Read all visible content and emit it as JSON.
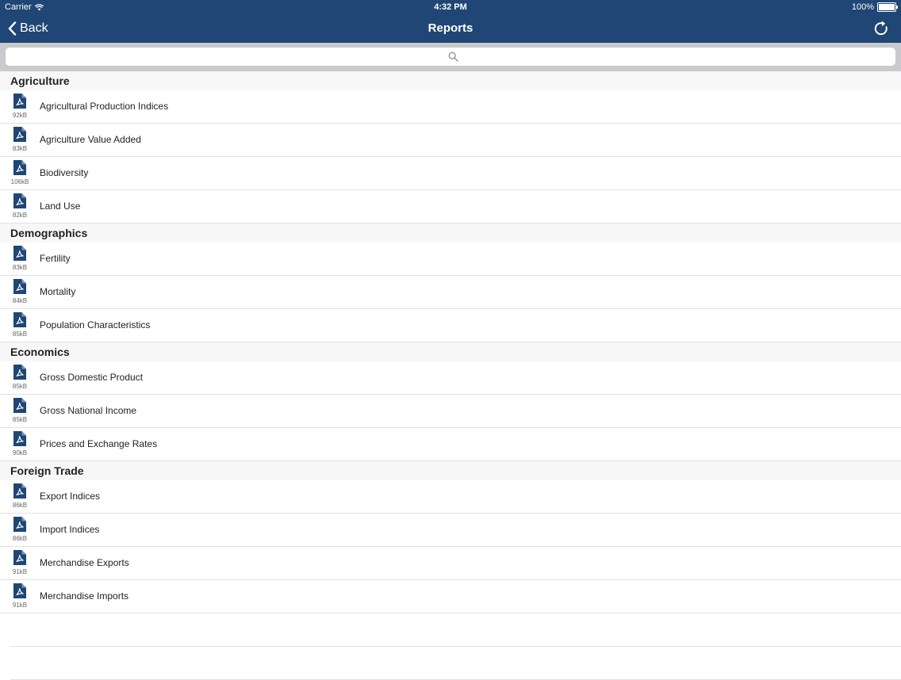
{
  "status_bar": {
    "carrier": "Carrier",
    "time": "4:32 PM",
    "battery": "100%",
    "battery_level": 1.0
  },
  "nav": {
    "back_label": "Back",
    "title": "Reports"
  },
  "search": {
    "placeholder": "",
    "value": ""
  },
  "colors": {
    "nav_background": "#1f4674",
    "pdf_icon": "#1f4674",
    "search_background": "#c9c9ce"
  },
  "sections": [
    {
      "title": "Agriculture",
      "items": [
        {
          "label": "Agricultural Production Indices",
          "size": "92kB",
          "icon": "pdf-icon"
        },
        {
          "label": "Agriculture Value Added",
          "size": "83kB",
          "icon": "pdf-icon"
        },
        {
          "label": "Biodiversity",
          "size": "106kB",
          "icon": "pdf-icon"
        },
        {
          "label": "Land Use",
          "size": "82kB",
          "icon": "pdf-icon"
        }
      ]
    },
    {
      "title": "Demographics",
      "items": [
        {
          "label": "Fertility",
          "size": "83kB",
          "icon": "pdf-icon"
        },
        {
          "label": "Mortality",
          "size": "84kB",
          "icon": "pdf-icon"
        },
        {
          "label": "Population Characteristics",
          "size": "85kB",
          "icon": "pdf-icon"
        }
      ]
    },
    {
      "title": "Economics",
      "items": [
        {
          "label": "Gross Domestic Product",
          "size": "85kB",
          "icon": "pdf-icon"
        },
        {
          "label": "Gross National Income",
          "size": "85kB",
          "icon": "pdf-icon"
        },
        {
          "label": "Prices and Exchange Rates",
          "size": "90kB",
          "icon": "pdf-icon"
        }
      ]
    },
    {
      "title": "Foreign Trade",
      "items": [
        {
          "label": "Export Indices",
          "size": "86kB",
          "icon": "pdf-icon"
        },
        {
          "label": "Import Indices",
          "size": "86kB",
          "icon": "pdf-icon"
        },
        {
          "label": "Merchandise Exports",
          "size": "91kB",
          "icon": "pdf-icon"
        },
        {
          "label": "Merchandise Imports",
          "size": "91kB",
          "icon": "pdf-icon"
        }
      ]
    }
  ]
}
